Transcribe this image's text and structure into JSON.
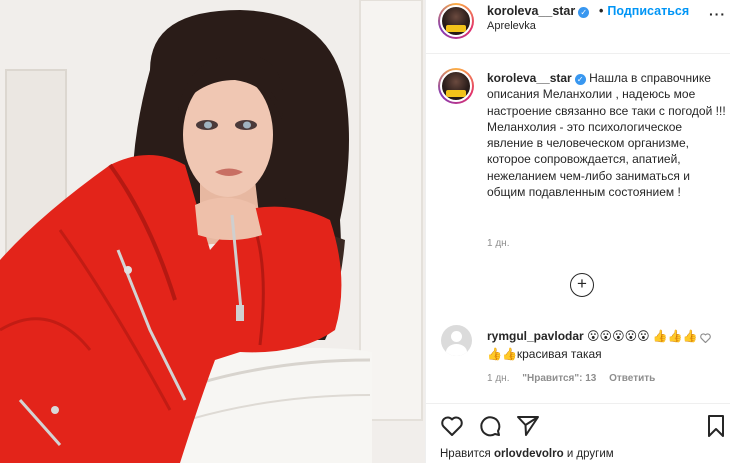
{
  "post": {
    "author": "koroleva__star",
    "location": "Aprelevka",
    "follow_label": "Подписаться",
    "separator": "•",
    "more_label": "···"
  },
  "caption": {
    "username": "koroleva__star",
    "text": "Нашла в справочнике описания Меланхолии , надеюсь мое настроение связанно все таки с погодой !!! Меланхолия - это психологическое явление в человеческом организме, которое сопровождается, апатией, нежеланием чем-либо заниматься и общим подавленным состоянием !",
    "time": "1 дн."
  },
  "load_more_label": "+",
  "comment": {
    "username": "rymgul_pavlodar",
    "text": "😮😮😮😮😮 👍👍👍👍👍красивая такая",
    "time": "1 дн.",
    "likes_label": "\"Нравится\": 13",
    "reply_label": "Ответить"
  },
  "likes": {
    "prefix": "Нравится",
    "user": "orlovdevolro",
    "suffix": "и другим"
  },
  "icons": {
    "like": "heart-icon",
    "comment": "comment-icon",
    "share": "paper-plane-icon",
    "save": "bookmark-icon",
    "verified": "verified-check-icon",
    "comment_like": "small-heart-icon"
  },
  "colors": {
    "link_blue": "#0095f6",
    "verified_blue": "#3897f0",
    "jacket_red": "#e3241a",
    "text_dark": "#262626",
    "text_gray": "#8e8e8e"
  }
}
